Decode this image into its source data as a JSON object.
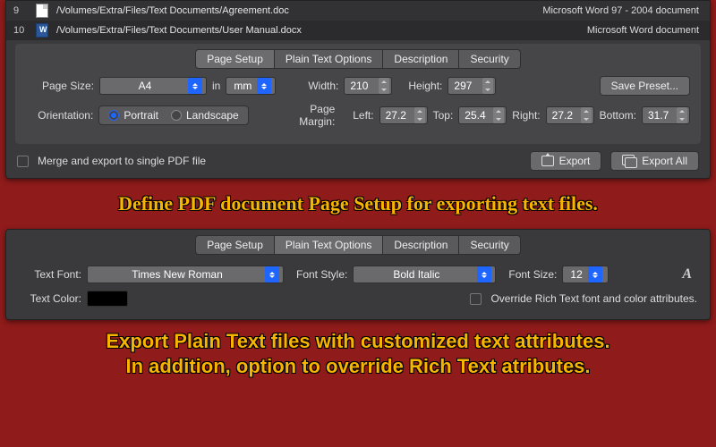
{
  "files": [
    {
      "index": "9",
      "path": "/Volumes/Extra/Files/Text Documents/Agreement.doc",
      "kind": "Microsoft Word 97 - 2004 document",
      "icon": "doc"
    },
    {
      "index": "10",
      "path": "/Volumes/Extra/Files/Text Documents/User Manual.docx",
      "kind": "Microsoft Word document",
      "icon": "docx"
    }
  ],
  "tabs": {
    "page_setup": "Page Setup",
    "plain_text": "Plain Text Options",
    "description": "Description",
    "security": "Security"
  },
  "page_setup": {
    "page_size_label": "Page Size:",
    "page_size_value": "A4",
    "in_label": "in",
    "unit_value": "mm",
    "width_label": "Width:",
    "width_value": "210",
    "height_label": "Height:",
    "height_value": "297",
    "save_preset": "Save Preset...",
    "orientation_label": "Orientation:",
    "portrait": "Portrait",
    "landscape": "Landscape",
    "orientation_value": "Portrait",
    "page_margin_label": "Page Margin:",
    "left_label": "Left:",
    "left_value": "27.2",
    "top_label": "Top:",
    "top_value": "25.4",
    "right_label": "Right:",
    "right_value": "27.2",
    "bottom_label": "Bottom:",
    "bottom_value": "31.7"
  },
  "bottom": {
    "merge_label": "Merge and export to single PDF file",
    "merge_checked": false,
    "export": "Export",
    "export_all": "Export All"
  },
  "caption1": "Define PDF document Page Setup for exporting text files.",
  "plain_text": {
    "text_font_label": "Text Font:",
    "text_font_value": "Times New Roman",
    "font_style_label": "Font Style:",
    "font_style_value": "Bold Italic",
    "font_size_label": "Font Size:",
    "font_size_value": "12",
    "text_color_label": "Text Color:",
    "text_color_value": "#000000",
    "override_label": "Override Rich Text font and color attributes.",
    "override_checked": false
  },
  "caption2a": "Export Plain Text files with customized text attributes.",
  "caption2b": "In addition, option to override Rich Text atributes."
}
